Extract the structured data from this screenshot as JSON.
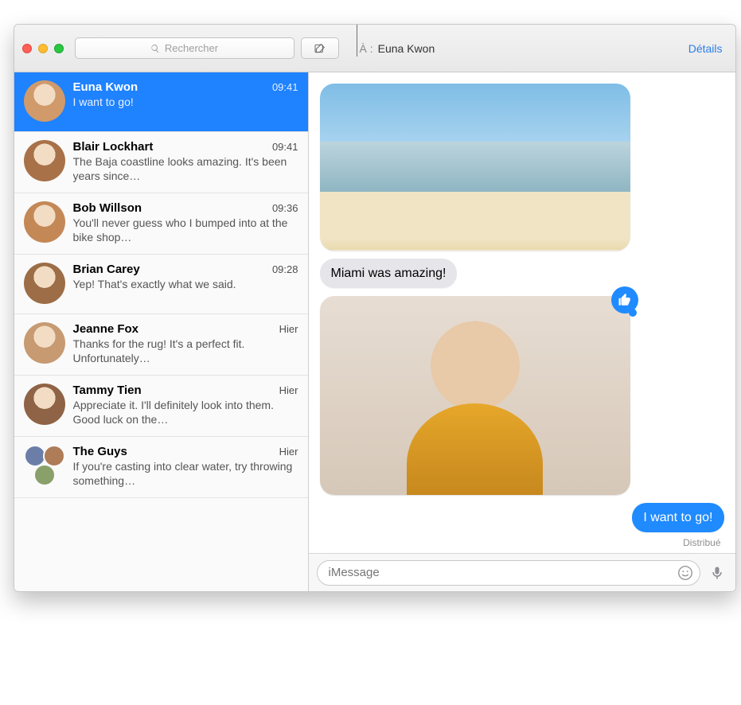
{
  "toolbar": {
    "search_placeholder": "Rechercher",
    "to_label": "À :",
    "to_value": "Euna Kwon",
    "details_label": "Détails"
  },
  "sidebar": {
    "items": [
      {
        "name": "Euna Kwon",
        "preview": "I want to go!",
        "time": "09:41",
        "selected": true,
        "group": false
      },
      {
        "name": "Blair Lockhart",
        "preview": "The Baja coastline looks amazing. It's been years since…",
        "time": "09:41",
        "selected": false,
        "group": false
      },
      {
        "name": "Bob Willson",
        "preview": "You'll never guess who I bumped into at the bike shop…",
        "time": "09:36",
        "selected": false,
        "group": false
      },
      {
        "name": "Brian Carey",
        "preview": "Yep! That's exactly what we said.",
        "time": "09:28",
        "selected": false,
        "group": false
      },
      {
        "name": "Jeanne Fox",
        "preview": "Thanks for the rug! It's a perfect fit. Unfortunately…",
        "time": "Hier",
        "selected": false,
        "group": false
      },
      {
        "name": "Tammy Tien",
        "preview": "Appreciate it. I'll definitely look into them. Good luck on the…",
        "time": "Hier",
        "selected": false,
        "group": false
      },
      {
        "name": "The Guys",
        "preview": "If you're casting into clear water, try throwing something…",
        "time": "Hier",
        "selected": false,
        "group": true
      }
    ]
  },
  "chat": {
    "miami_text": "Miami was amazing!",
    "sent_text": "I want to go!",
    "receipt": "Distribué",
    "input_placeholder": "iMessage"
  },
  "avatar_tints": [
    "#d09a6b",
    "#a87148",
    "#c48857",
    "#9c6d46",
    "#c79a72",
    "#8f6346"
  ]
}
